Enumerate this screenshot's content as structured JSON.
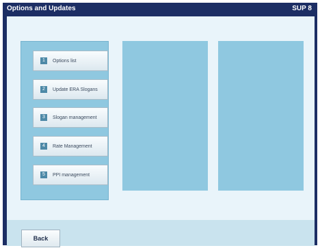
{
  "window": {
    "title": "Options and Updates",
    "code": "SUP 8"
  },
  "menu": {
    "items": [
      {
        "number": "1",
        "label": "Options list"
      },
      {
        "number": "2",
        "label": "Update ERA Slogans"
      },
      {
        "number": "3",
        "label": "Slogan management"
      },
      {
        "number": "4",
        "label": "Rate Management"
      },
      {
        "number": "5",
        "label": "PPI management"
      }
    ]
  },
  "footer": {
    "back_label": "Back"
  },
  "colors": {
    "frame": "#1c2e64",
    "content_bg": "#e9f4fa",
    "panel": "#8fc8e0",
    "footer_bg": "#c9e3ee",
    "number_badge": "#4d89a7"
  }
}
